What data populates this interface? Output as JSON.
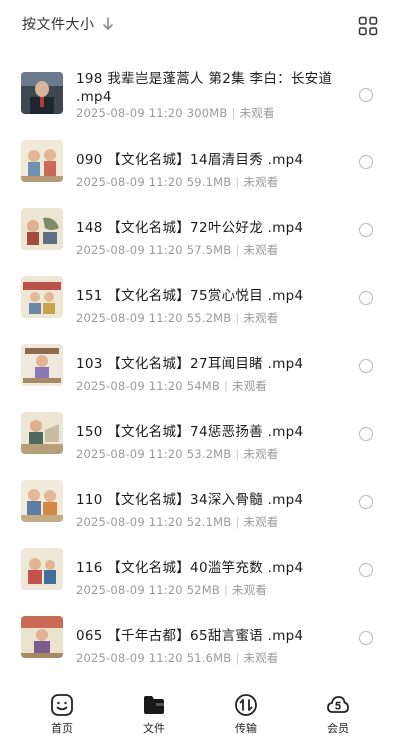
{
  "header": {
    "sort_label": "按文件大小",
    "sort_icon": "arrow-down-icon",
    "view_icon": "grid-view-icon"
  },
  "files": [
    {
      "title": "198 我辈岂是蓬蒿人 第2集 李白：长安道 .mp4",
      "date": "2025-08-09 11:20",
      "size": "300MB",
      "status": "未观看"
    },
    {
      "title": "090 【文化名城】14眉清目秀 .mp4",
      "date": "2025-08-09 11:20",
      "size": "59.1MB",
      "status": "未观看"
    },
    {
      "title": "148 【文化名城】72叶公好龙 .mp4",
      "date": "2025-08-09 11:20",
      "size": "57.5MB",
      "status": "未观看"
    },
    {
      "title": "151 【文化名城】75赏心悦目 .mp4",
      "date": "2025-08-09 11:20",
      "size": "55.2MB",
      "status": "未观看"
    },
    {
      "title": "103 【文化名城】27耳闻目睹 .mp4",
      "date": "2025-08-09 11:20",
      "size": "54MB",
      "status": "未观看"
    },
    {
      "title": "150 【文化名城】74惩恶扬善 .mp4",
      "date": "2025-08-09 11:20",
      "size": "53.2MB",
      "status": "未观看"
    },
    {
      "title": "110 【文化名城】34深入骨髓 .mp4",
      "date": "2025-08-09 11:20",
      "size": "52.1MB",
      "status": "未观看"
    },
    {
      "title": "116 【文化名城】40滥竽充数 .mp4",
      "date": "2025-08-09 11:20",
      "size": "52MB",
      "status": "未观看"
    },
    {
      "title": "065 【千年古都】65甜言蜜语 .mp4",
      "date": "2025-08-09 11:20",
      "size": "51.6MB",
      "status": "未观看"
    }
  ],
  "tabs": [
    {
      "label": "首页",
      "icon": "home-face-icon"
    },
    {
      "label": "文件",
      "icon": "folder-icon",
      "active": true
    },
    {
      "label": "传输",
      "icon": "transfer-icon"
    },
    {
      "label": "会员",
      "icon": "vip-cloud-icon"
    }
  ],
  "colors": {
    "text": "#1c1c1c",
    "meta": "#9a9a9a",
    "radio_border": "#b8b8b8"
  }
}
